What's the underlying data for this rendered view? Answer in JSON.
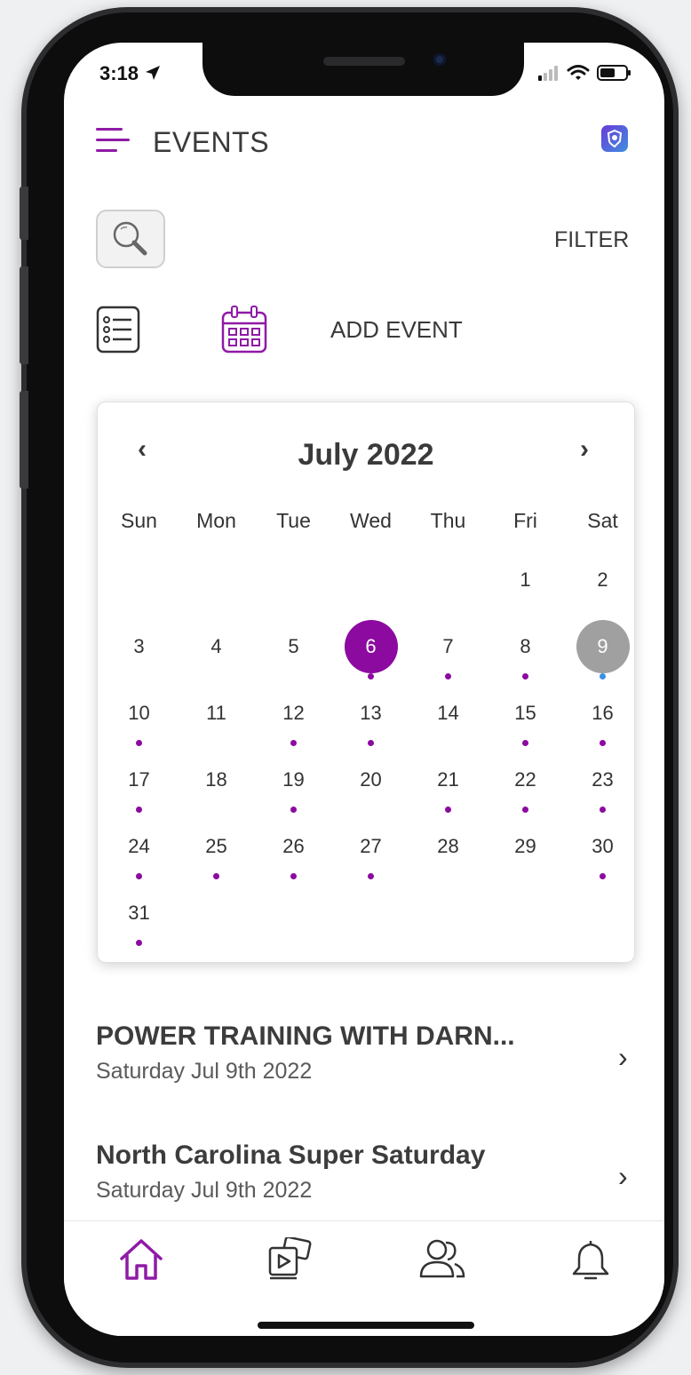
{
  "status_bar": {
    "time": "3:18"
  },
  "header": {
    "title": "EVENTS"
  },
  "toolbar": {
    "filter_label": "FILTER",
    "add_event_label": "ADD EVENT"
  },
  "calendar": {
    "month_label": "July 2022",
    "weekdays": [
      "Sun",
      "Mon",
      "Tue",
      "Wed",
      "Thu",
      "Fri",
      "Sat"
    ],
    "selected_day": 6,
    "today_day": 9,
    "days": [
      {
        "n": "1"
      },
      {
        "n": "2"
      },
      {
        "n": "3"
      },
      {
        "n": "4"
      },
      {
        "n": "5"
      },
      {
        "n": "6",
        "dot": "purple"
      },
      {
        "n": "7",
        "dot": "purple"
      },
      {
        "n": "8",
        "dot": "purple"
      },
      {
        "n": "9",
        "dot": "blue"
      },
      {
        "n": "10",
        "dot": "purple"
      },
      {
        "n": "11"
      },
      {
        "n": "12",
        "dot": "purple"
      },
      {
        "n": "13",
        "dot": "purple"
      },
      {
        "n": "14"
      },
      {
        "n": "15",
        "dot": "purple"
      },
      {
        "n": "16",
        "dot": "purple"
      },
      {
        "n": "17",
        "dot": "purple"
      },
      {
        "n": "18"
      },
      {
        "n": "19",
        "dot": "purple"
      },
      {
        "n": "20"
      },
      {
        "n": "21",
        "dot": "purple"
      },
      {
        "n": "22",
        "dot": "purple"
      },
      {
        "n": "23",
        "dot": "purple"
      },
      {
        "n": "24",
        "dot": "purple"
      },
      {
        "n": "25",
        "dot": "purple"
      },
      {
        "n": "26",
        "dot": "purple"
      },
      {
        "n": "27",
        "dot": "purple"
      },
      {
        "n": "28"
      },
      {
        "n": "29"
      },
      {
        "n": "30",
        "dot": "purple"
      },
      {
        "n": "31",
        "dot": "purple"
      }
    ],
    "first_weekday_index": 5
  },
  "events": [
    {
      "title": "POWER TRAINING WITH DARN...",
      "date": "Saturday Jul 9th 2022"
    },
    {
      "title": "North Carolina Super Saturday",
      "date": "Saturday Jul 9th 2022"
    }
  ],
  "tabs": [
    {
      "icon": "home-icon",
      "active": true
    },
    {
      "icon": "media-icon",
      "active": false
    },
    {
      "icon": "people-icon",
      "active": false
    },
    {
      "icon": "bell-icon",
      "active": false
    }
  ],
  "colors": {
    "accent": "#8c0aa0",
    "today": "#a0a0a0",
    "event_dot_alt": "#3b8fe6"
  }
}
